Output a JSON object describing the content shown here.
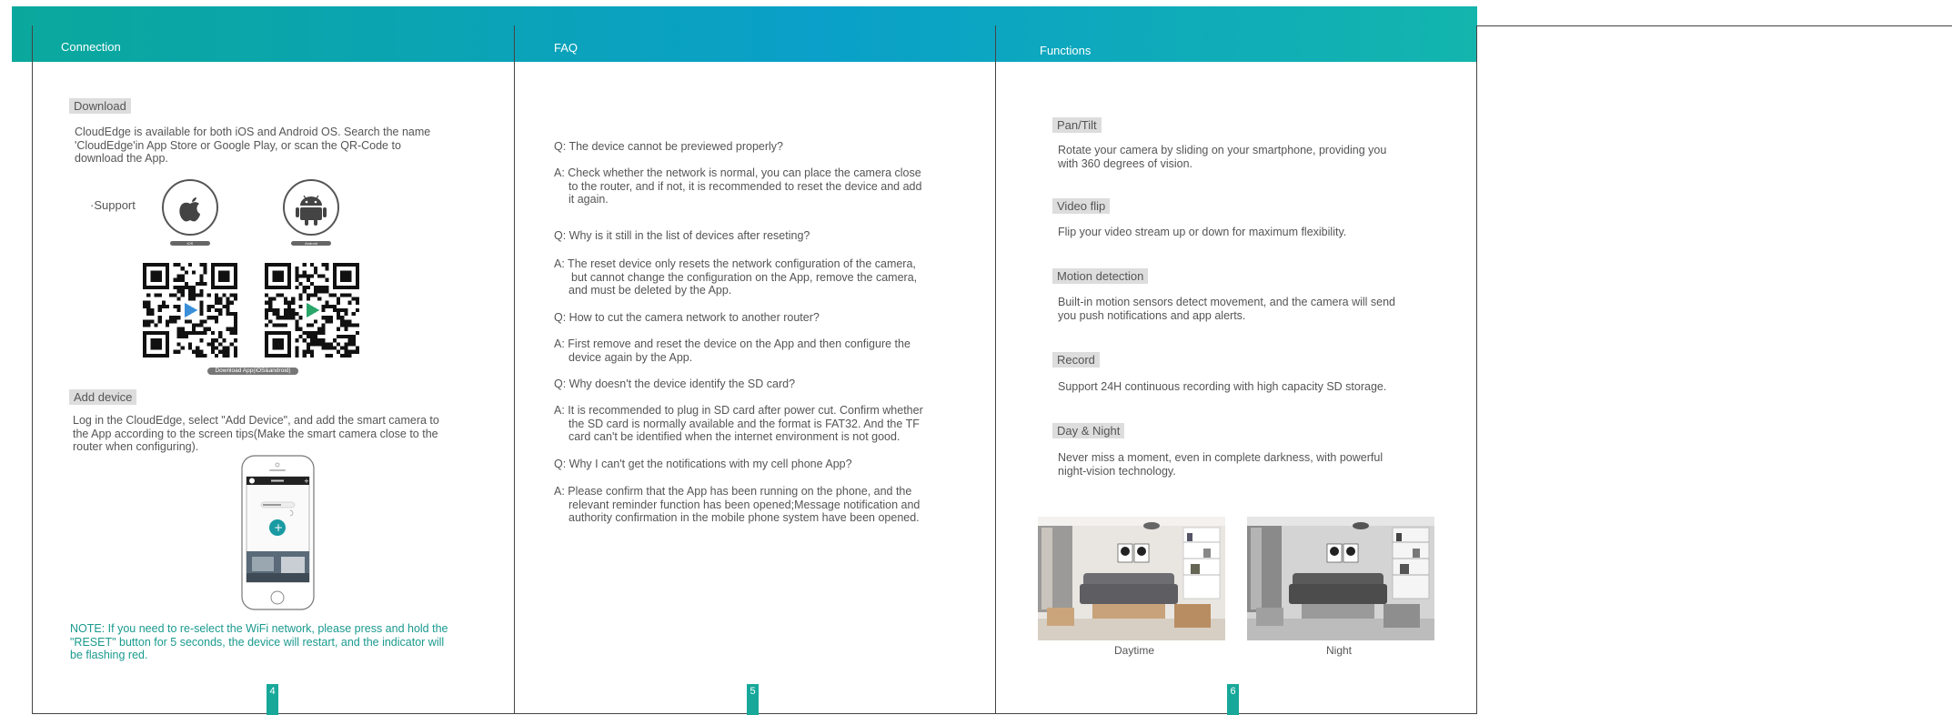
{
  "headers": {
    "connection": "Connection",
    "faq": "FAQ",
    "functions": "Functions"
  },
  "connection": {
    "download_tag": "Download",
    "download_text": [
      "CloudEdge is available for both iOS and Android OS. Search the name",
      "'CloudEdge'in App Store or Google Play, or scan the QR-Code to",
      "download the App."
    ],
    "support_label": "·Support",
    "ios_badge": "iOS",
    "android_badge": "Android",
    "qr_caption": "Download App(iOS&android)",
    "add_device_tag": "Add device",
    "add_device_text": [
      "Log in the CloudEdge, select \"Add Device\", and add the smart camera to",
      "the App according to the screen tips(Make the smart camera close to the",
      "router when configuring)."
    ],
    "note": [
      "NOTE: If you need to re-select the WiFi network, please press and hold the",
      "\"RESET\" button for 5 seconds, the device will restart, and the indicator will",
      "be flashing red."
    ],
    "page_number": "4"
  },
  "faq": {
    "items": [
      {
        "q": "Q: The device cannot be previewed properly?",
        "a": [
          "A: Check whether the network is normal, you can place the camera close",
          "to the router, and if not, it is recommended to reset the device and add",
          "it again."
        ]
      },
      {
        "q": "Q: Why is it still in the list of devices after reseting?",
        "a": [
          "A: The reset device only resets the network configuration of the camera,",
          "but cannot change the configuration on the App, remove the camera,",
          "and must be deleted by the App."
        ]
      },
      {
        "q": "Q: How to cut the camera network to another router?",
        "a": [
          "A: First remove and reset the device on the App and then configure the",
          "device again by the App."
        ]
      },
      {
        "q": "Q: Why doesn't the device identify the SD card?",
        "a": [
          "A: It is recommended to plug in SD card after power cut. Confirm whether",
          "the SD card is normally available and the format is FAT32. And the TF",
          "card can't be identified when the internet environment is not good."
        ]
      },
      {
        "q": "Q: Why I can't get the notifications with my cell phone App?",
        "a": [
          "A: Please confirm that the App has been running on the phone, and the",
          "relevant reminder function has been opened;Message notification and",
          "authority confirmation in the mobile phone system have been opened."
        ]
      }
    ],
    "page_number": "5"
  },
  "functions": {
    "items": [
      {
        "tag": "Pan/Tilt",
        "text": [
          "Rotate your camera by sliding on your smartphone, providing you",
          "with 360 degrees of vision."
        ]
      },
      {
        "tag": "Video flip",
        "text": [
          "Flip your video stream up or down for maximum flexibility."
        ]
      },
      {
        "tag": "Motion detection",
        "text": [
          "Built-in motion sensors detect movement, and the camera will send",
          "you push notifications and app alerts."
        ]
      },
      {
        "tag": "Record",
        "text": [
          "Support 24H continuous recording with high capacity SD storage."
        ]
      },
      {
        "tag": "Day & Night",
        "text": [
          "Never miss a moment, even in complete darkness, with powerful",
          "night-vision technology."
        ]
      }
    ],
    "daytime_caption": "Daytime",
    "night_caption": "Night",
    "page_number": "6"
  },
  "colors": {
    "header_start": "#0aa89c",
    "header_end": "#0aa0c9",
    "accent": "#17a89a",
    "tag_bg": "#dddddd"
  }
}
